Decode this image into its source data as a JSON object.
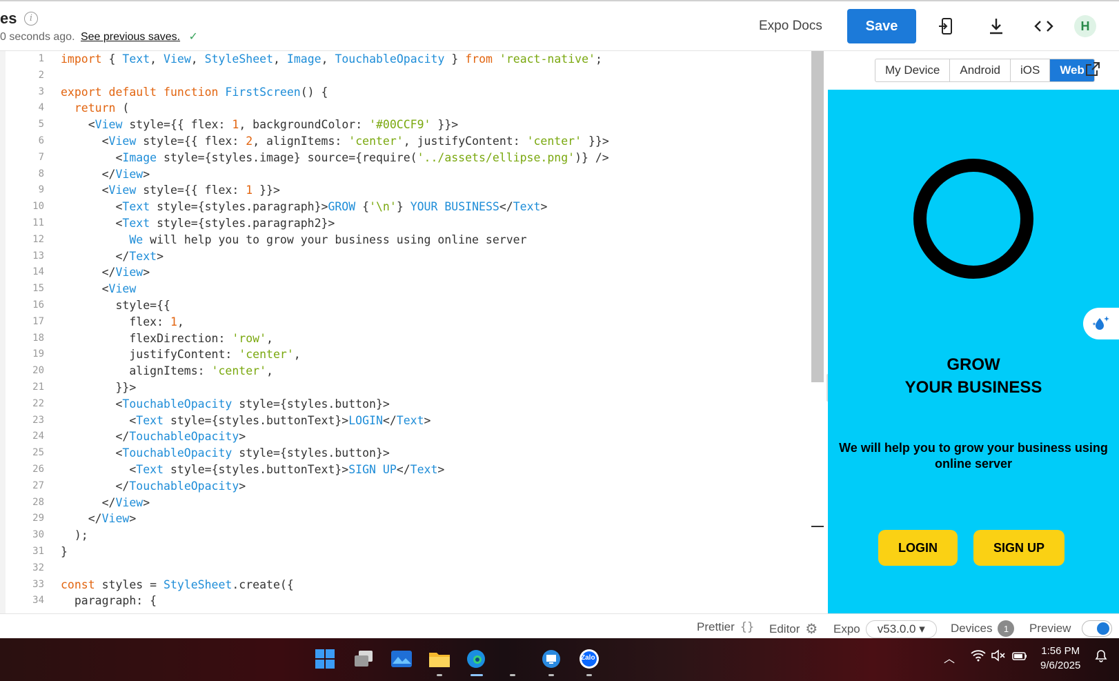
{
  "header": {
    "title": "es",
    "save_status": "0 seconds ago.",
    "previous_saves_link": "See previous saves.",
    "docs_link": "Expo Docs",
    "save_label": "Save",
    "avatar_initial": "H"
  },
  "editor": {
    "line_numbers": [
      "1",
      "2",
      "3",
      "4",
      "5",
      "6",
      "7",
      "8",
      "9",
      "10",
      "11",
      "12",
      "13",
      "14",
      "15",
      "16",
      "17",
      "18",
      "19",
      "20",
      "21",
      "22",
      "23",
      "24",
      "25",
      "26",
      "27",
      "28",
      "29",
      "30",
      "31",
      "32",
      "33",
      "34"
    ]
  },
  "preview": {
    "tabs": [
      "My Device",
      "Android",
      "iOS",
      "Web"
    ],
    "active_tab": "Web",
    "app_heading_line1": "GROW",
    "app_heading_line2": "YOUR BUSINESS",
    "app_paragraph": "We will help you to grow your business using online server",
    "login_label": "LOGIN",
    "signup_label": "SIGN UP",
    "background_color": "#00CCF9",
    "button_color": "#FAD114"
  },
  "statusbar": {
    "prettier": "Prettier",
    "prettier_icon": "{}",
    "editor": "Editor",
    "expo": "Expo",
    "sdk_version": "v53.0.0 ▾",
    "devices": "Devices",
    "devices_count": "1",
    "preview": "Preview"
  },
  "taskbar": {
    "time": "1:56 PM",
    "date": "9/6/2025",
    "zalo_label": "Zalo"
  }
}
